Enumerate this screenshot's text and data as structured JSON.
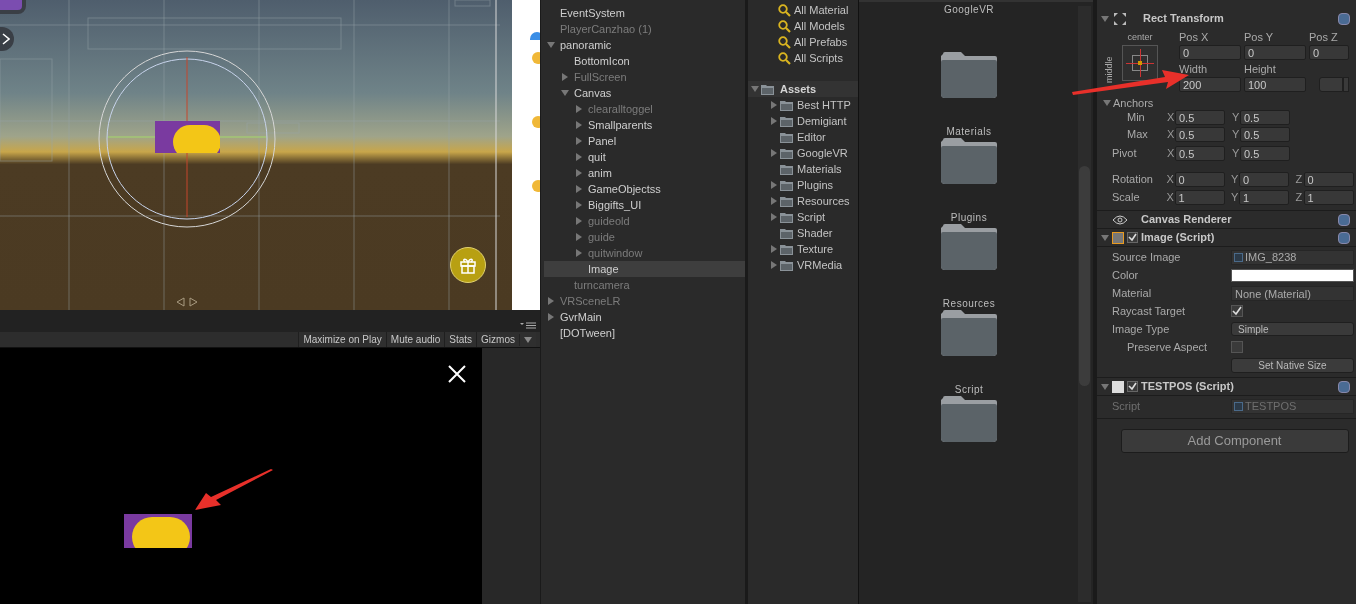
{
  "game_toolbar": {
    "buttons": [
      "Maximize on Play",
      "Mute audio",
      "Stats",
      "Gizmos"
    ]
  },
  "hierarchy": {
    "items": [
      {
        "label": "EventSystem",
        "active": true
      },
      {
        "label": "PlayerCanzhao (1)",
        "active": false
      },
      {
        "label": "panoramic",
        "active": true,
        "expanded": true,
        "children": [
          {
            "label": "BottomIcon",
            "active": true
          },
          {
            "label": "FullScreen",
            "active": false,
            "expanded": false
          },
          {
            "label": "Canvas",
            "active": true,
            "expanded": true,
            "children": [
              {
                "label": "clearalltoggel",
                "active": false,
                "expanded": false
              },
              {
                "label": "Smallparents",
                "active": true,
                "expanded": false
              },
              {
                "label": "Panel",
                "active": true,
                "expanded": false
              },
              {
                "label": "quit",
                "active": true,
                "expanded": false
              },
              {
                "label": "anim",
                "active": true,
                "expanded": false
              },
              {
                "label": "GameObjectss",
                "active": true,
                "expanded": false
              },
              {
                "label": "Biggifts_UI",
                "active": true,
                "expanded": false
              },
              {
                "label": "guideold",
                "active": false,
                "expanded": false
              },
              {
                "label": "guide",
                "active": false,
                "expanded": false
              },
              {
                "label": "quitwindow",
                "active": false,
                "expanded": false
              },
              {
                "label": "Image",
                "active": true,
                "selected": true
              }
            ]
          },
          {
            "label": "turncamera",
            "active": false
          }
        ]
      },
      {
        "label": "VRSceneLR",
        "active": false,
        "expanded": false
      },
      {
        "label": "GvrMain",
        "active": true,
        "expanded": false
      },
      {
        "label": "[DOTween]",
        "active": true
      }
    ]
  },
  "project": {
    "favorites": [
      "All Material",
      "All Models",
      "All Prefabs",
      "All Scripts"
    ],
    "assets": {
      "label": "Assets",
      "expanded": true,
      "children": [
        {
          "label": "Best HTTP",
          "expanded": false
        },
        {
          "label": "Demigiant",
          "expanded": false
        },
        {
          "label": "Editor"
        },
        {
          "label": "GoogleVR",
          "expanded": false
        },
        {
          "label": "Materials"
        },
        {
          "label": "Plugins",
          "expanded": false
        },
        {
          "label": "Resources",
          "expanded": false
        },
        {
          "label": "Script",
          "expanded": false
        },
        {
          "label": "Shader"
        },
        {
          "label": "Texture",
          "expanded": false
        },
        {
          "label": "VRMedia",
          "expanded": false
        }
      ]
    },
    "grid": [
      {
        "kind": "label_only",
        "label": "GoogleVR"
      },
      {
        "kind": "folder",
        "label": "Materials"
      },
      {
        "kind": "folder",
        "label": "Plugins"
      },
      {
        "kind": "folder",
        "label": "Resources"
      },
      {
        "kind": "folder",
        "label": "Script"
      },
      {
        "kind": "icon_only"
      }
    ]
  },
  "inspector": {
    "rect_transform": {
      "title": "Rect Transform",
      "anchor_h": "center",
      "anchor_v": "middle",
      "position": [
        {
          "label": "Pos X",
          "value": "0"
        },
        {
          "label": "Pos Y",
          "value": "0"
        },
        {
          "label": "Pos Z",
          "value": "0"
        }
      ],
      "size": [
        {
          "label": "Width",
          "value": "200"
        },
        {
          "label": "Height",
          "value": "100"
        }
      ],
      "anchors": {
        "label": "Anchors",
        "expanded": true,
        "rows": [
          {
            "label": "Min",
            "axes": [
              {
                "axis": "X",
                "value": "0.5"
              },
              {
                "axis": "Y",
                "value": "0.5"
              }
            ]
          },
          {
            "label": "Max",
            "axes": [
              {
                "axis": "X",
                "value": "0.5"
              },
              {
                "axis": "Y",
                "value": "0.5"
              }
            ]
          }
        ]
      },
      "pivot": {
        "label": "Pivot",
        "axes": [
          {
            "axis": "X",
            "value": "0.5"
          },
          {
            "axis": "Y",
            "value": "0.5"
          }
        ]
      },
      "transform_rows": [
        {
          "label": "Rotation",
          "axes": [
            {
              "axis": "X",
              "value": "0"
            },
            {
              "axis": "Y",
              "value": "0"
            },
            {
              "axis": "Z",
              "value": "0"
            }
          ]
        },
        {
          "label": "Scale",
          "axes": [
            {
              "axis": "X",
              "value": "1"
            },
            {
              "axis": "Y",
              "value": "1"
            },
            {
              "axis": "Z",
              "value": "1"
            }
          ]
        }
      ]
    },
    "components": [
      {
        "kind": "renderer",
        "title": "Canvas Renderer"
      },
      {
        "kind": "image_script",
        "title": "Image (Script)",
        "enabled": true,
        "expanded": true,
        "props": [
          {
            "kind": "object",
            "label": "Source Image",
            "value": "IMG_8238"
          },
          {
            "kind": "color",
            "label": "Color",
            "color": "#ffffff"
          },
          {
            "kind": "text",
            "label": "Material",
            "value": "None (Material)"
          },
          {
            "kind": "checkbox",
            "label": "Raycast Target",
            "checked": true
          },
          {
            "kind": "dropdown",
            "label": "Image Type",
            "value": "Simple"
          },
          {
            "kind": "checkbox",
            "label": "Preserve Aspect",
            "checked": false,
            "indented": true
          },
          {
            "kind": "button",
            "value": "Set Native Size"
          }
        ]
      },
      {
        "kind": "mono_script",
        "title": "TESTPOS (Script)",
        "enabled": true,
        "expanded": true,
        "props": [
          {
            "kind": "object",
            "label": "Script",
            "value": "TESTPOS",
            "disabled": true
          }
        ]
      }
    ],
    "add_component": "Add Component"
  }
}
